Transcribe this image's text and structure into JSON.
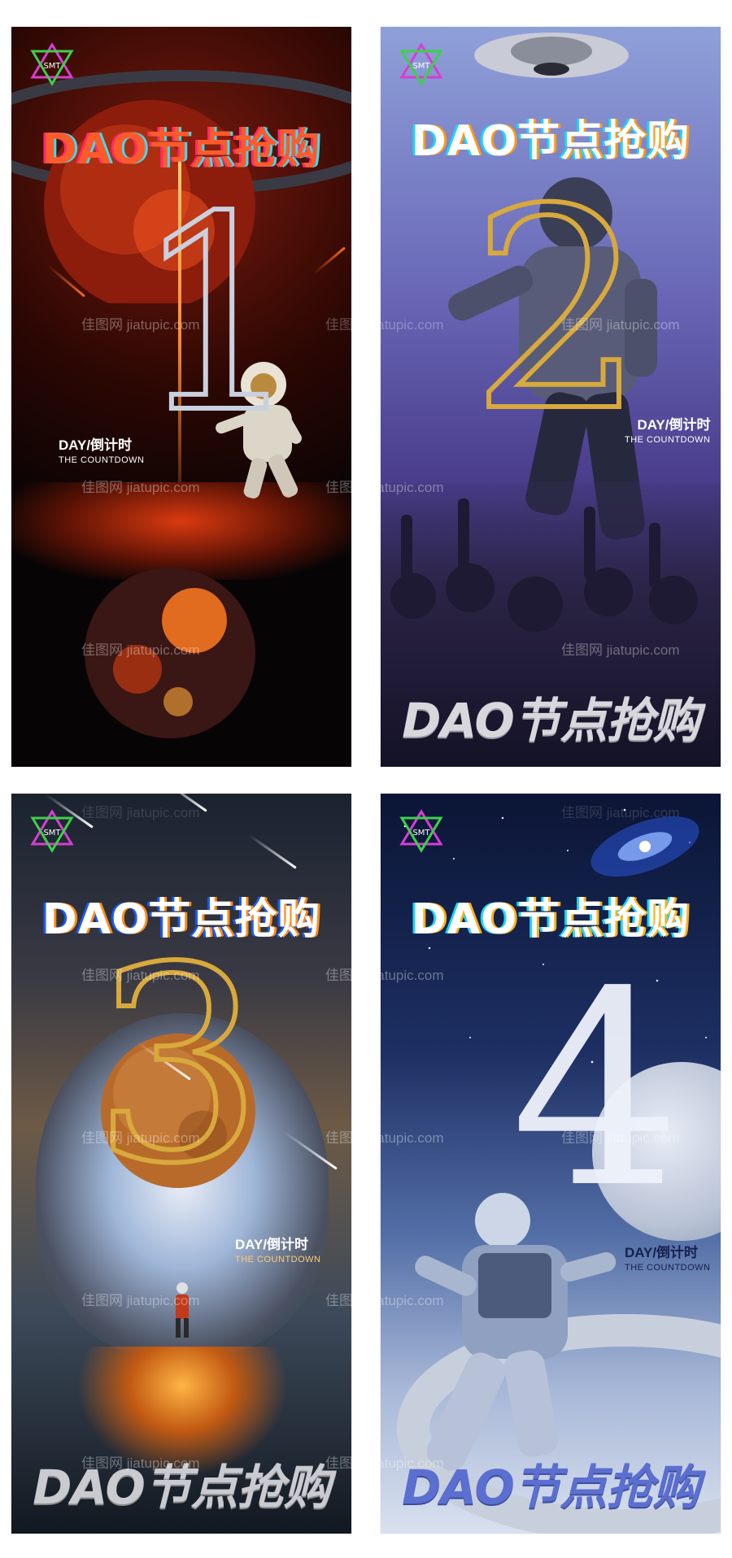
{
  "posters": [
    {
      "title": "DAO节点抢购",
      "digit": "1",
      "countdown_day": "DAY/倒计时",
      "countdown_sub": "THE COUNTDOWN",
      "logo_text": "SMT"
    },
    {
      "title": "DAO节点抢购",
      "digit": "2",
      "countdown_day": "DAY/倒计时",
      "countdown_sub": "THE COUNTDOWN",
      "logo_text": "SMT",
      "bottom_title": "DAO节点抢购"
    },
    {
      "title": "DAO节点抢购",
      "digit": "3",
      "countdown_day": "DAY/倒计时",
      "countdown_sub": "THE COUNTDOWN",
      "logo_text": "SMT",
      "bottom_title": "DAO节点抢购"
    },
    {
      "title": "DAO节点抢购",
      "digit": "4",
      "countdown_day": "DAY/倒计时",
      "countdown_sub": "THE COUNTDOWN",
      "logo_text": "SMT",
      "bottom_title": "DAO节点抢购"
    }
  ],
  "watermark": "佳图网 jiatupic.com",
  "colors": {
    "poster1_accent": "#ff5a2a",
    "poster2_accent": "#d8a93c",
    "poster3_accent": "#d8a93c",
    "poster4_accent": "#5b6fd0",
    "glitch_cyan": "#19d8ff",
    "glitch_orange": "#ff9a1a"
  },
  "icons": [
    "star-of-david-logo-icon",
    "planet-icon",
    "astronaut-icon",
    "meteor-icon",
    "ufo-icon",
    "galaxy-icon",
    "moon-icon"
  ]
}
